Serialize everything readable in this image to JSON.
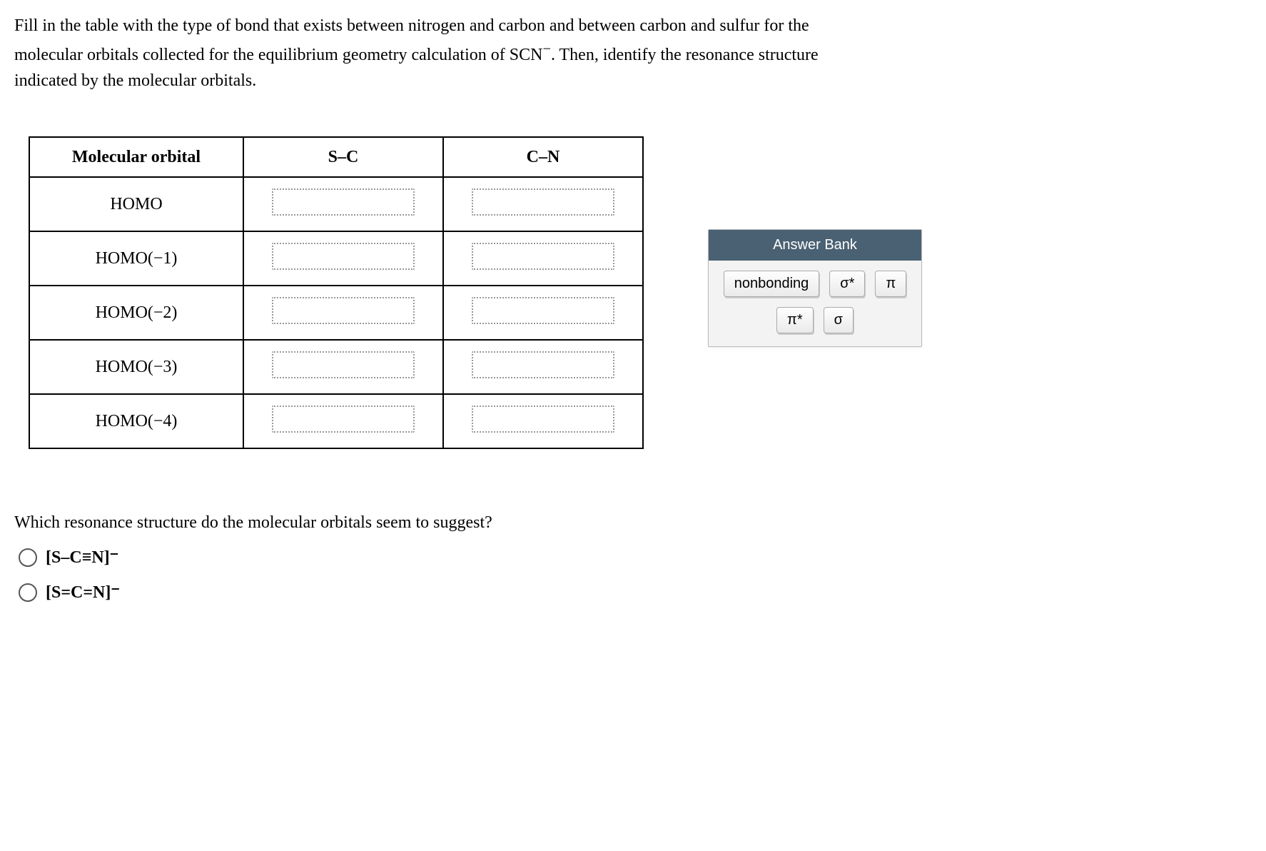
{
  "prompt": {
    "line1": "Fill in the table with the type of bond that exists between nitrogen and carbon and between carbon and sulfur for the",
    "line2a": "molecular orbitals collected for the equilibrium geometry calculation of SCN",
    "line2b": ". Then, identify the resonance structure",
    "superscript": "−",
    "line3": "indicated by the molecular orbitals."
  },
  "table": {
    "headers": {
      "mo": "Molecular orbital",
      "sc": "S–C",
      "cn": "C–N"
    },
    "rows": [
      {
        "label": "HOMO"
      },
      {
        "label": "HOMO(−1)"
      },
      {
        "label": "HOMO(−2)"
      },
      {
        "label": "HOMO(−3)"
      },
      {
        "label": "HOMO(−4)"
      }
    ]
  },
  "answer_bank": {
    "title": "Answer Bank",
    "items": [
      "nonbonding",
      "σ*",
      "π",
      "π*",
      "σ"
    ]
  },
  "resonance_question": "Which resonance structure do the molecular orbitals seem to suggest?",
  "options": [
    {
      "label": "[S–C≡N]⁻"
    },
    {
      "label": "[S=C=N]⁻"
    }
  ]
}
